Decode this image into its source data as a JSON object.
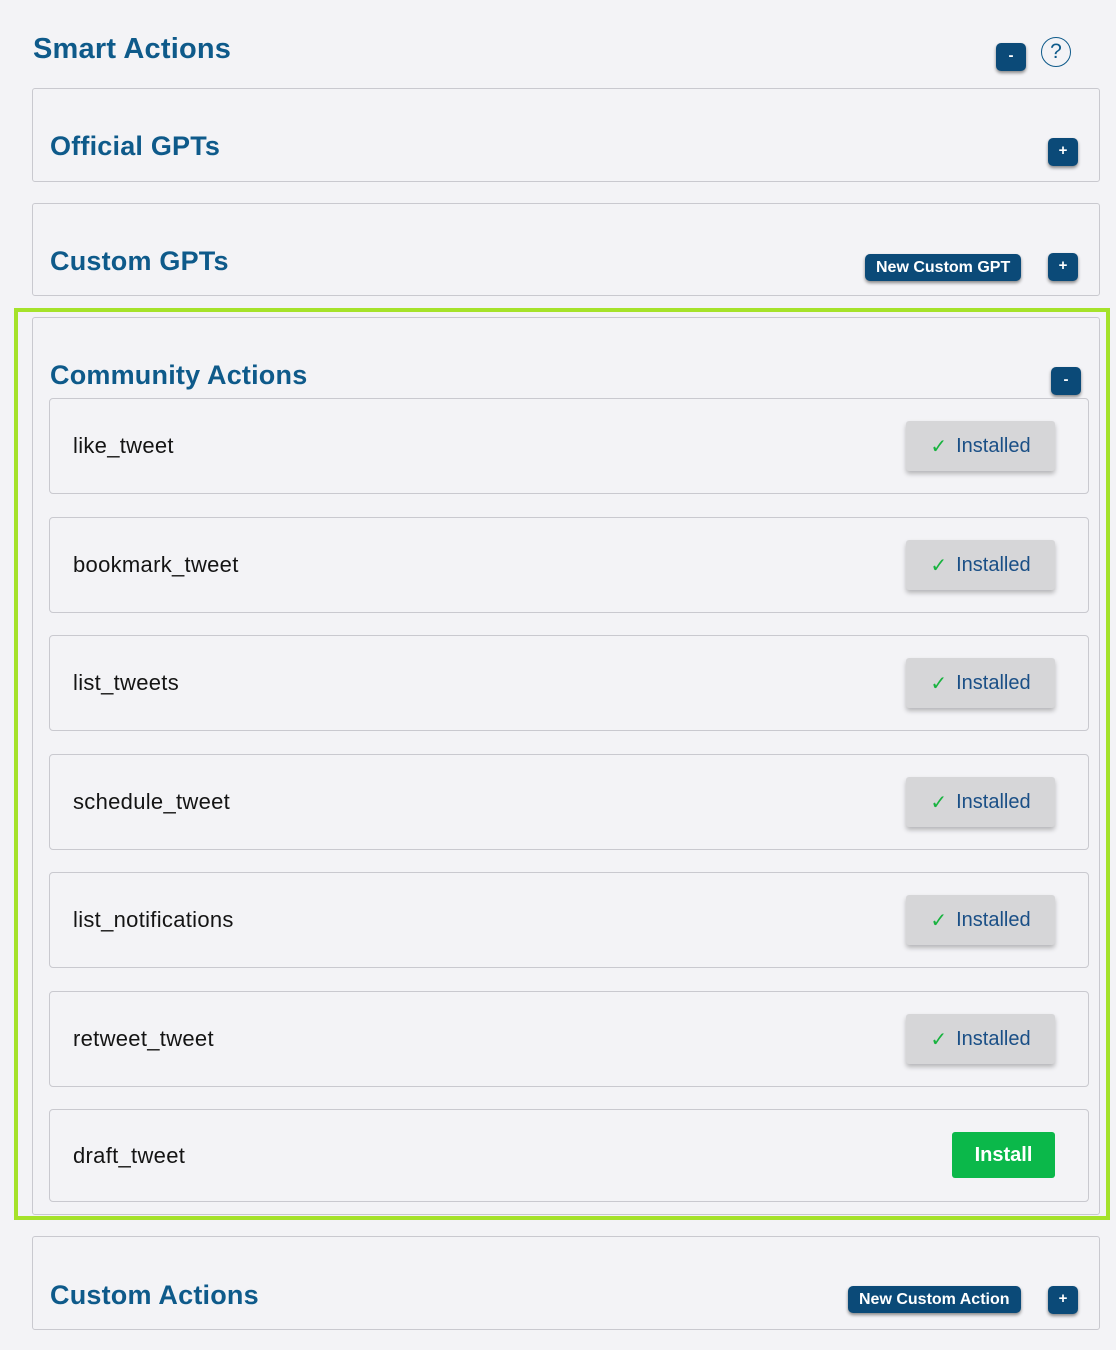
{
  "header": {
    "title": "Smart Actions",
    "collapse_label": "-",
    "help_label": "?"
  },
  "sections": {
    "official_gpts": {
      "title": "Official GPTs",
      "toggle_label": "+"
    },
    "custom_gpts": {
      "title": "Custom GPTs",
      "new_label": "New Custom GPT",
      "toggle_label": "+"
    },
    "community_actions": {
      "title": "Community Actions",
      "toggle_label": "-",
      "installed_label": "Installed",
      "install_label": "Install",
      "check_glyph": "✓",
      "items": [
        {
          "name": "like_tweet",
          "status": "installed"
        },
        {
          "name": "bookmark_tweet",
          "status": "installed"
        },
        {
          "name": "list_tweets",
          "status": "installed"
        },
        {
          "name": "schedule_tweet",
          "status": "installed"
        },
        {
          "name": "list_notifications",
          "status": "installed"
        },
        {
          "name": "retweet_tweet",
          "status": "installed"
        },
        {
          "name": "draft_tweet",
          "status": "not_installed"
        }
      ]
    },
    "custom_actions": {
      "title": "Custom Actions",
      "new_label": "New Custom Action",
      "toggle_label": "+"
    }
  },
  "colors": {
    "accent": "#0e5a8a",
    "button_dark": "#0b4a78",
    "highlight": "#a5e22a",
    "install_green": "#0bb84a",
    "check_green": "#18b33f"
  }
}
